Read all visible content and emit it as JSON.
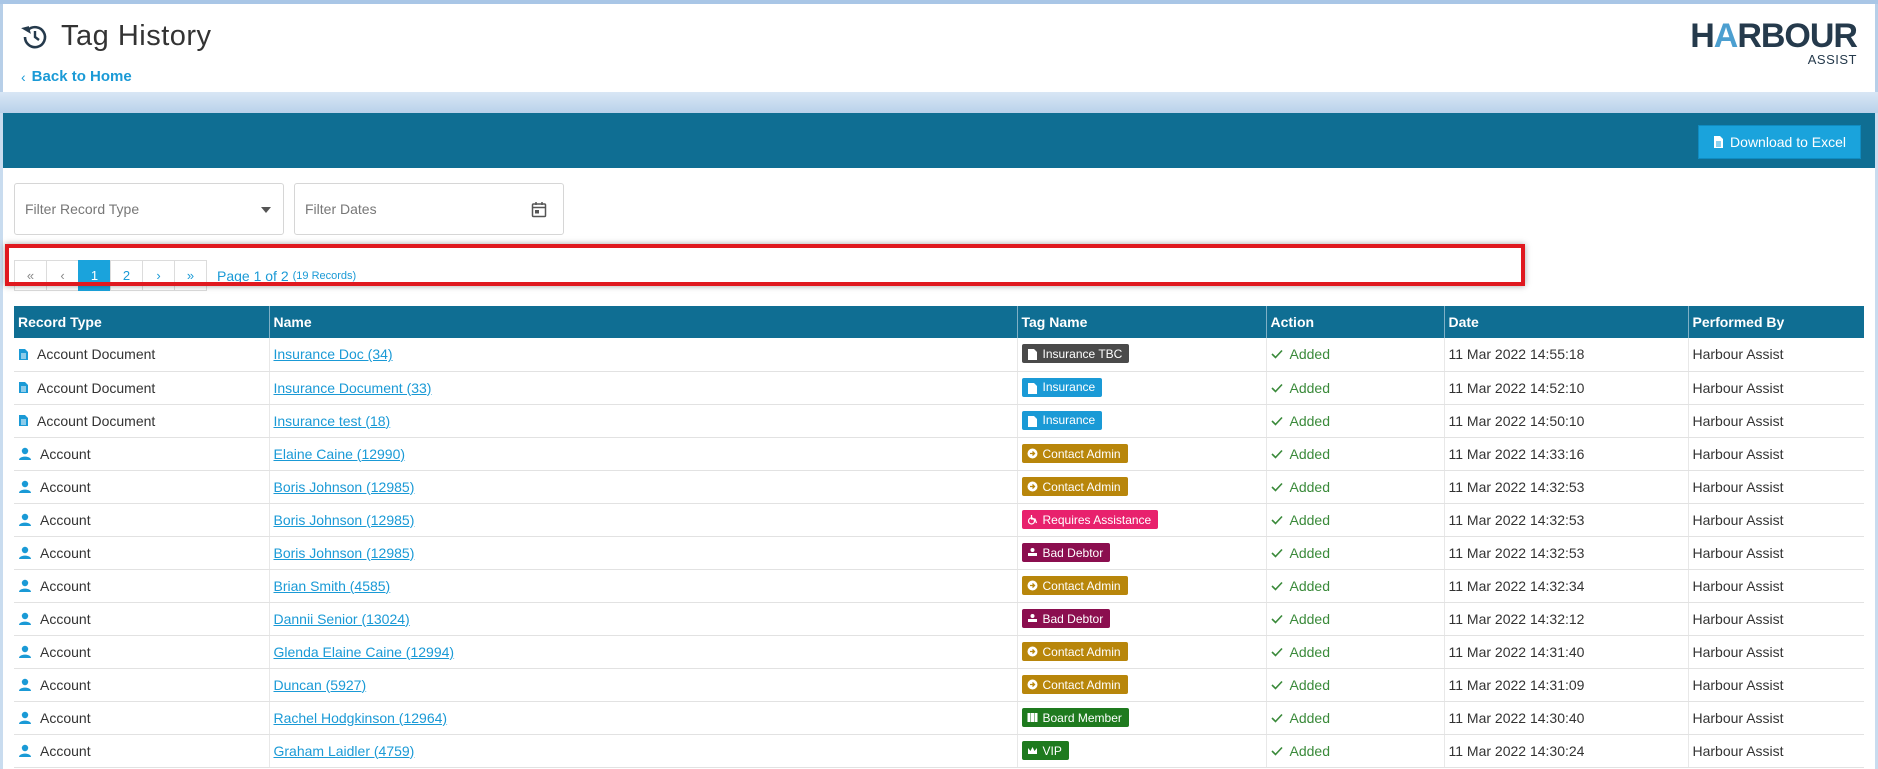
{
  "header": {
    "title": "Tag History",
    "back_label": "Back to Home",
    "logo_main_left": "H",
    "logo_main_arch": "A",
    "logo_main_right": "RBOUR",
    "logo_sub": "ASSIST"
  },
  "toolbar": {
    "excel_label": "Download to Excel"
  },
  "filters": {
    "record_type_placeholder": "Filter Record Type",
    "dates_placeholder": "Filter Dates"
  },
  "pagination": {
    "first": "«",
    "prev": "‹",
    "pages": [
      "1",
      "2"
    ],
    "current_page": "1",
    "next": "›",
    "last": "»",
    "info": "Page 1 of 2",
    "records": "(19 Records)"
  },
  "table": {
    "columns": [
      "Record Type",
      "Name",
      "Tag Name",
      "Action",
      "Date",
      "Performed By"
    ],
    "rows": [
      {
        "record_type": "Account Document",
        "rt_icon": "document-icon",
        "name": "Insurance Doc (34)",
        "tag": "Insurance TBC",
        "tag_color": "#4a4a4a",
        "tag_icon": "document-icon",
        "action": "Added",
        "date": "11 Mar 2022 14:55:18",
        "by": "Harbour Assist"
      },
      {
        "record_type": "Account Document",
        "rt_icon": "document-icon",
        "name": "Insurance Document (33)",
        "tag": "Insurance",
        "tag_color": "#1a9ad6",
        "tag_icon": "document-icon",
        "action": "Added",
        "date": "11 Mar 2022 14:52:10",
        "by": "Harbour Assist"
      },
      {
        "record_type": "Account Document",
        "rt_icon": "document-icon",
        "name": "Insurance test (18)",
        "tag": "Insurance",
        "tag_color": "#1a9ad6",
        "tag_icon": "document-icon",
        "action": "Added",
        "date": "11 Mar 2022 14:50:10",
        "by": "Harbour Assist"
      },
      {
        "record_type": "Account",
        "rt_icon": "user-icon",
        "name": "Elaine Caine (12990)",
        "tag": "Contact Admin",
        "tag_color": "#b8860b",
        "tag_icon": "arrow-circle-icon",
        "action": "Added",
        "date": "11 Mar 2022 14:33:16",
        "by": "Harbour Assist"
      },
      {
        "record_type": "Account",
        "rt_icon": "user-icon",
        "name": "Boris Johnson (12985)",
        "tag": "Contact Admin",
        "tag_color": "#b8860b",
        "tag_icon": "arrow-circle-icon",
        "action": "Added",
        "date": "11 Mar 2022 14:32:53",
        "by": "Harbour Assist"
      },
      {
        "record_type": "Account",
        "rt_icon": "user-icon",
        "name": "Boris Johnson (12985)",
        "tag": "Requires Assistance",
        "tag_color": "#e8216d",
        "tag_icon": "wheelchair-icon",
        "action": "Added",
        "date": "11 Mar 2022 14:32:53",
        "by": "Harbour Assist"
      },
      {
        "record_type": "Account",
        "rt_icon": "user-icon",
        "name": "Boris Johnson (12985)",
        "tag": "Bad Debtor",
        "tag_color": "#8b0e4f",
        "tag_icon": "hand-icon",
        "action": "Added",
        "date": "11 Mar 2022 14:32:53",
        "by": "Harbour Assist"
      },
      {
        "record_type": "Account",
        "rt_icon": "user-icon",
        "name": "Brian Smith (4585)",
        "tag": "Contact Admin",
        "tag_color": "#b8860b",
        "tag_icon": "arrow-circle-icon",
        "action": "Added",
        "date": "11 Mar 2022 14:32:34",
        "by": "Harbour Assist"
      },
      {
        "record_type": "Account",
        "rt_icon": "user-icon",
        "name": "Dannii Senior (13024)",
        "tag": "Bad Debtor",
        "tag_color": "#8b0e4f",
        "tag_icon": "hand-icon",
        "action": "Added",
        "date": "11 Mar 2022 14:32:12",
        "by": "Harbour Assist"
      },
      {
        "record_type": "Account",
        "rt_icon": "user-icon",
        "name": "Glenda Elaine Caine (12994)",
        "tag": "Contact Admin",
        "tag_color": "#b8860b",
        "tag_icon": "arrow-circle-icon",
        "action": "Added",
        "date": "11 Mar 2022 14:31:40",
        "by": "Harbour Assist"
      },
      {
        "record_type": "Account",
        "rt_icon": "user-icon",
        "name": "Duncan (5927)",
        "tag": "Contact Admin",
        "tag_color": "#b8860b",
        "tag_icon": "arrow-circle-icon",
        "action": "Added",
        "date": "11 Mar 2022 14:31:09",
        "by": "Harbour Assist"
      },
      {
        "record_type": "Account",
        "rt_icon": "user-icon",
        "name": "Rachel Hodgkinson (12964)",
        "tag": "Board Member",
        "tag_color": "#1e7a1e",
        "tag_icon": "group-icon",
        "action": "Added",
        "date": "11 Mar 2022 14:30:40",
        "by": "Harbour Assist"
      },
      {
        "record_type": "Account",
        "rt_icon": "user-icon",
        "name": "Graham Laidler (4759)",
        "tag": "VIP",
        "tag_color": "#1e7a1e",
        "tag_icon": "crown-icon",
        "action": "Added",
        "date": "11 Mar 2022 14:30:24",
        "by": "Harbour Assist"
      }
    ]
  },
  "colors": {
    "primary": "#0f6e93",
    "accent": "#1aa3dc",
    "highlight": "#e0191f"
  }
}
